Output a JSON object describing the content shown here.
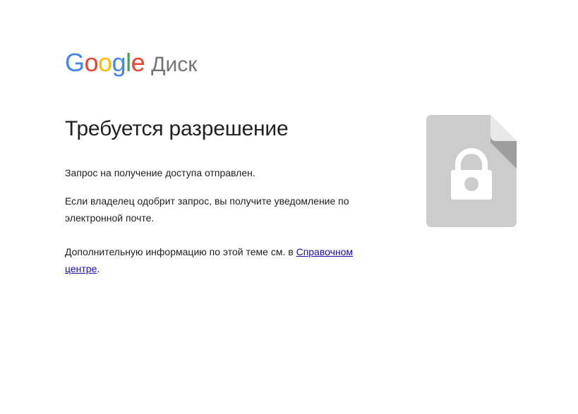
{
  "logo": {
    "letters": [
      "G",
      "o",
      "o",
      "g",
      "l",
      "e"
    ],
    "letter_colors": [
      "#4285F4",
      "#EA4335",
      "#FBBC05",
      "#4285F4",
      "#34A853",
      "#EA4335"
    ],
    "product": "Диск"
  },
  "page": {
    "title": "Требуется разрешение",
    "request_sent": "Запрос на получение доступа отправлен.",
    "owner_approval": "Если владелец одобрит запрос, вы получите уведомление по электронной почте.",
    "more_info_prefix": "Дополнительную информацию по этой теме см. в ",
    "help_link_text": "Справочном центре",
    "more_info_suffix": "."
  },
  "illustration": {
    "icon": "locked-file-icon",
    "file_color": "#cccccc",
    "fold_color": "#9e9e9e",
    "lock_color": "#ffffff"
  }
}
